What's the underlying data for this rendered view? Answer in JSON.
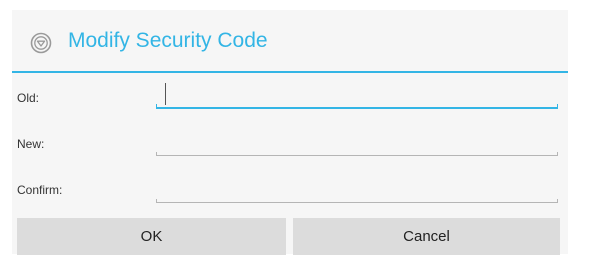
{
  "dialog": {
    "title": "Modify Security Code",
    "icon": "security-shield-icon",
    "accent_color": "#33b5e5"
  },
  "fields": [
    {
      "label": "Old:",
      "value": "",
      "focused": true
    },
    {
      "label": "New:",
      "value": "",
      "focused": false
    },
    {
      "label": "Confirm:",
      "value": "",
      "focused": false
    }
  ],
  "buttons": {
    "ok_label": "OK",
    "cancel_label": "Cancel"
  }
}
